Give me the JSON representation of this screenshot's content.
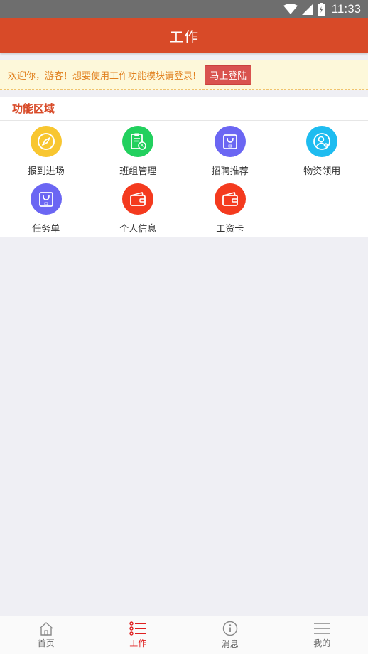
{
  "status_bar": {
    "time": "11:33"
  },
  "header": {
    "title": "工作"
  },
  "notice": {
    "text": "欢迎你，游客！想要使用工作功能模块请登录!",
    "login_label": "马上登陆"
  },
  "section": {
    "title": "功能区域",
    "items": [
      {
        "label": "报到进场",
        "icon": "compass-icon",
        "color": "#f8c630"
      },
      {
        "label": "班组管理",
        "icon": "clipboard-clock-icon",
        "color": "#22d05e"
      },
      {
        "label": "招聘推荐",
        "icon": "shopping-bag-icon",
        "color": "#6b66f3"
      },
      {
        "label": "物资领用",
        "icon": "user-circle-icon",
        "color": "#1ebcf0"
      },
      {
        "label": "任务单",
        "icon": "shopping-bag-icon",
        "color": "#6b66f3"
      },
      {
        "label": "个人信息",
        "icon": "wallet-icon",
        "color": "#f43a1e"
      },
      {
        "label": "工资卡",
        "icon": "wallet-icon",
        "color": "#f43a1e"
      }
    ]
  },
  "bottom_nav": {
    "items": [
      {
        "label": "首页",
        "icon": "home-icon",
        "active": false
      },
      {
        "label": "工作",
        "icon": "list-icon",
        "active": true
      },
      {
        "label": "消息",
        "icon": "info-icon",
        "active": false
      },
      {
        "label": "我的",
        "icon": "menu-icon",
        "active": false
      }
    ],
    "active_color": "#e02020"
  }
}
